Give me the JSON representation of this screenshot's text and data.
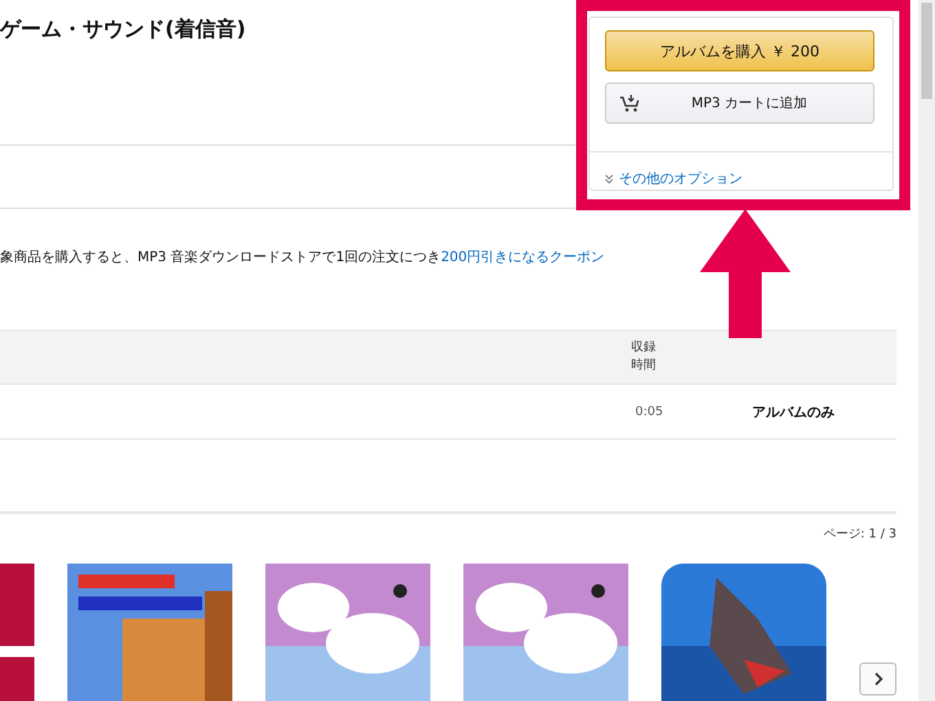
{
  "title": "ゲーム・サウンド(着信音)",
  "buy_box": {
    "buy_button": "アルバムを購入 ￥ 200",
    "cart_button": "MP3 カートに追加",
    "more_options": "その他のオプション"
  },
  "coupon": {
    "text": "象商品を購入すると、MP3 音楽ダウンロードストアで1回の注文につき",
    "link": "200円引きになるクーポン"
  },
  "tracks": {
    "columns": [
      {
        "label": "収録時間"
      }
    ],
    "rows": [
      {
        "duration": "0:05",
        "purchase": "アルバムのみ"
      }
    ]
  },
  "carousel": {
    "page": "ページ: 1 / 3"
  }
}
